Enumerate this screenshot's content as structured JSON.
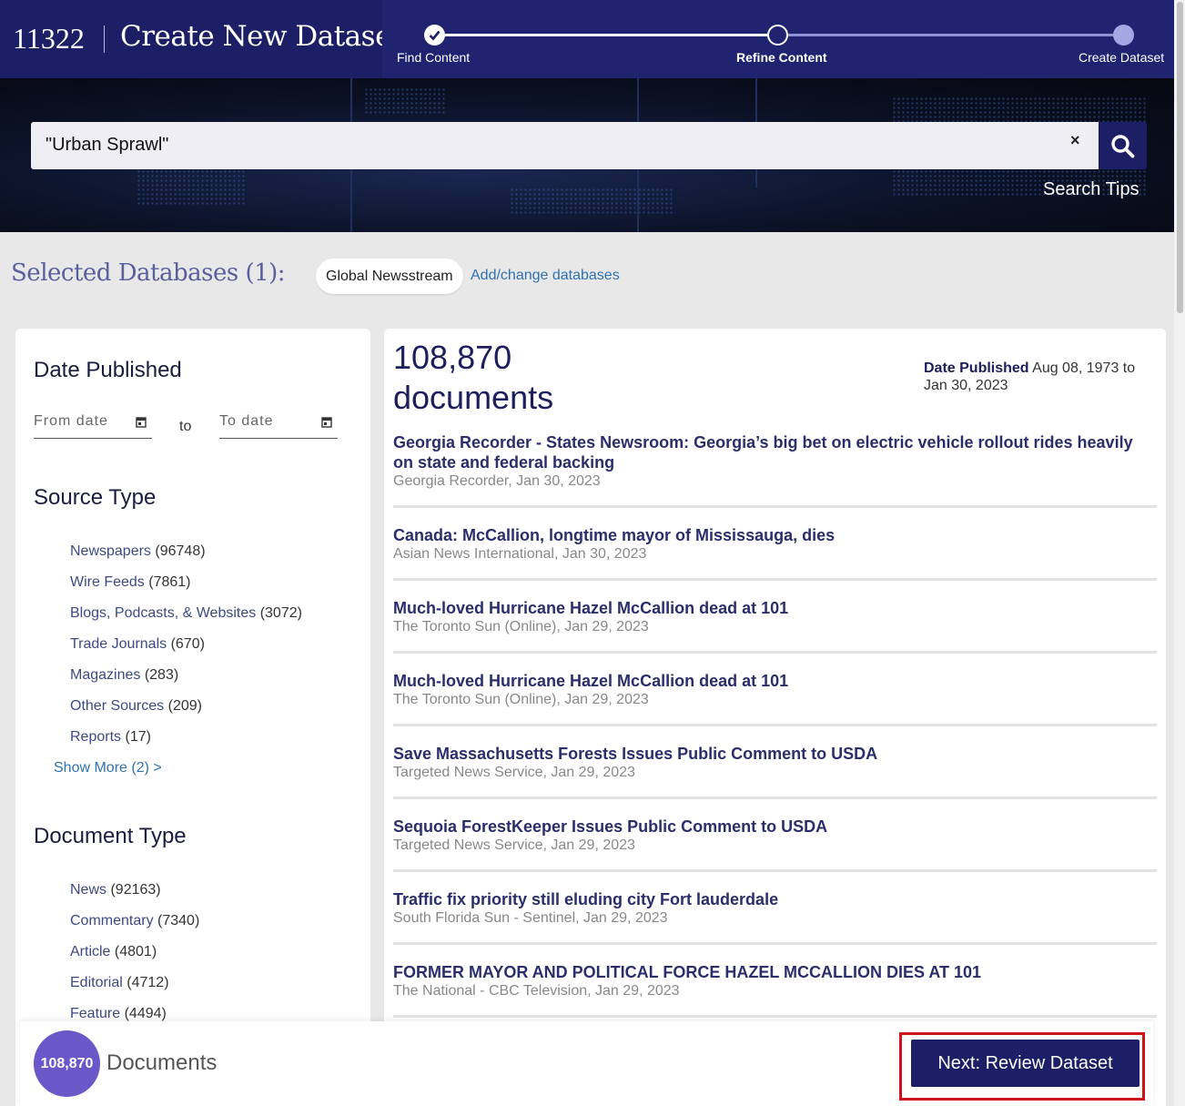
{
  "header": {
    "project_id": "11322",
    "title": "Create New Dataset",
    "steps": [
      {
        "label": "Find Content",
        "state": "done"
      },
      {
        "label": "Refine Content",
        "state": "current"
      },
      {
        "label": "Create Dataset",
        "state": "todo"
      }
    ]
  },
  "search": {
    "query": "\"Urban Sprawl\"",
    "clear_label": "×",
    "tips_label": "Search Tips"
  },
  "databases": {
    "title": "Selected Databases (1):",
    "selected": "Global Newsstream",
    "change_label": "Add/change databases"
  },
  "filters": {
    "date_heading": "Date Published",
    "from_placeholder": "From date",
    "to_word": "to",
    "to_placeholder": "To date",
    "source_heading": "Source Type",
    "source_items": [
      {
        "label": "Newspapers",
        "count": "(96748)"
      },
      {
        "label": "Wire Feeds",
        "count": "(7861)"
      },
      {
        "label": "Blogs, Podcasts, & Websites",
        "count": "(3072)"
      },
      {
        "label": "Trade Journals",
        "count": "(670)"
      },
      {
        "label": "Magazines",
        "count": "(283)"
      },
      {
        "label": "Other Sources",
        "count": "(209)"
      },
      {
        "label": "Reports",
        "count": "(17)"
      }
    ],
    "show_more": "Show More (2) >",
    "doctype_heading": "Document Type",
    "doctype_items": [
      {
        "label": "News",
        "count": "(92163)"
      },
      {
        "label": "Commentary",
        "count": "(7340)"
      },
      {
        "label": "Article",
        "count": "(4801)"
      },
      {
        "label": "Editorial",
        "count": "(4712)"
      },
      {
        "label": "Feature",
        "count": "(4494)"
      }
    ]
  },
  "results": {
    "count_line1": "108,870",
    "count_line2": "documents",
    "date_label": "Date Published",
    "date_range": "Aug 08, 1973 to Jan 30, 2023",
    "items": [
      {
        "title": "Georgia Recorder - States Newsroom: Georgia’s big bet on electric vehicle rollout rides heavily on state and federal backing",
        "source": "Georgia Recorder, Jan 30, 2023"
      },
      {
        "title": "Canada: McCallion, longtime mayor of Mississauga, dies",
        "source": "Asian News International, Jan 30, 2023"
      },
      {
        "title": "Much-loved Hurricane Hazel McCallion dead at 101",
        "source": "The Toronto Sun (Online), Jan 29, 2023"
      },
      {
        "title": "Much-loved Hurricane Hazel McCallion dead at 101",
        "source": "The Toronto Sun (Online), Jan 29, 2023"
      },
      {
        "title": "Save Massachusetts Forests Issues Public Comment to USDA",
        "source": "Targeted News Service, Jan 29, 2023"
      },
      {
        "title": "Sequoia ForestKeeper Issues Public Comment to USDA",
        "source": "Targeted News Service, Jan 29, 2023"
      },
      {
        "title": "Traffic fix priority still eluding city Fort lauderdale",
        "source": "South Florida Sun - Sentinel, Jan 29, 2023"
      },
      {
        "title": "FORMER MAYOR AND POLITICAL FORCE HAZEL MCCALLION DIES AT 101",
        "source": "The National - CBC Television, Jan 29, 2023"
      }
    ]
  },
  "footer": {
    "count": "108,870",
    "label": "Documents",
    "next_label": "Next: Review Dataset"
  },
  "colors": {
    "header_bg": "#1c1f66",
    "accent_purple": "#6a57c8",
    "link_blue": "#2f72b0",
    "highlight_red": "#d0121b"
  }
}
